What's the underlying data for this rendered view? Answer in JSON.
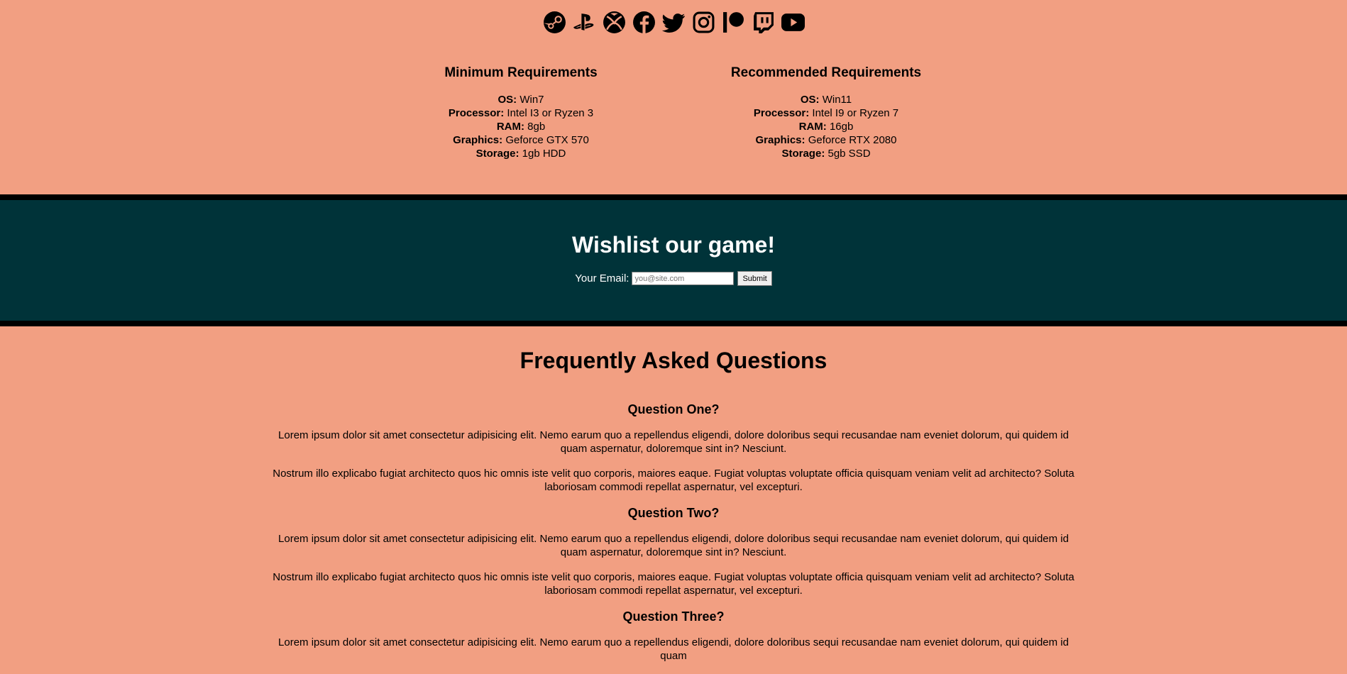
{
  "social": [
    {
      "name": "steam-icon"
    },
    {
      "name": "playstation-icon"
    },
    {
      "name": "xbox-icon"
    },
    {
      "name": "facebook-icon"
    },
    {
      "name": "twitter-icon"
    },
    {
      "name": "instagram-icon"
    },
    {
      "name": "patreon-icon"
    },
    {
      "name": "twitch-icon"
    },
    {
      "name": "youtube-icon"
    }
  ],
  "requirements": {
    "minimum": {
      "title": "Minimum Requirements",
      "os_label": "OS:",
      "os": "Win7",
      "processor_label": "Processor:",
      "processor": "Intel I3 or Ryzen 3",
      "ram_label": "RAM:",
      "ram": "8gb",
      "graphics_label": "Graphics:",
      "graphics": "Geforce GTX 570",
      "storage_label": "Storage:",
      "storage": "1gb HDD"
    },
    "recommended": {
      "title": "Recommended Requirements",
      "os_label": "OS:",
      "os": "Win11",
      "processor_label": "Processor:",
      "processor": "Intel I9 or Ryzen 7",
      "ram_label": "RAM:",
      "ram": "16gb",
      "graphics_label": "Graphics:",
      "graphics": "Geforce RTX 2080",
      "storage_label": "Storage:",
      "storage": "5gb SSD"
    }
  },
  "wishlist": {
    "title": "Wishlist our game!",
    "email_label": "Your Email:",
    "email_placeholder": "you@site.com",
    "email_value": "",
    "submit_label": "Submit"
  },
  "faq": {
    "title": "Frequently Asked Questions",
    "items": [
      {
        "question": "Question One?",
        "p1": "Lorem ipsum dolor sit amet consectetur adipisicing elit. Nemo earum quo a repellendus eligendi, dolore doloribus sequi recusandae nam eveniet dolorum, qui quidem id quam aspernatur, doloremque sint in? Nesciunt.",
        "p2": "Nostrum illo explicabo fugiat architecto quos hic omnis iste velit quo corporis, maiores eaque. Fugiat voluptas voluptate officia quisquam veniam velit ad architecto? Soluta laboriosam commodi repellat aspernatur, vel excepturi."
      },
      {
        "question": "Question Two?",
        "p1": "Lorem ipsum dolor sit amet consectetur adipisicing elit. Nemo earum quo a repellendus eligendi, dolore doloribus sequi recusandae nam eveniet dolorum, qui quidem id quam aspernatur, doloremque sint in? Nesciunt.",
        "p2": "Nostrum illo explicabo fugiat architecto quos hic omnis iste velit quo corporis, maiores eaque. Fugiat voluptas voluptate officia quisquam veniam velit ad architecto? Soluta laboriosam commodi repellat aspernatur, vel excepturi."
      },
      {
        "question": "Question Three?",
        "p1": "Lorem ipsum dolor sit amet consectetur adipisicing elit. Nemo earum quo a repellendus eligendi, dolore doloribus sequi recusandae nam eveniet dolorum, qui quidem id quam"
      }
    ]
  },
  "colors": {
    "page_bg": "#f29f82",
    "band_bg": "#003339",
    "border": "#000000",
    "band_text": "#ffffff"
  }
}
